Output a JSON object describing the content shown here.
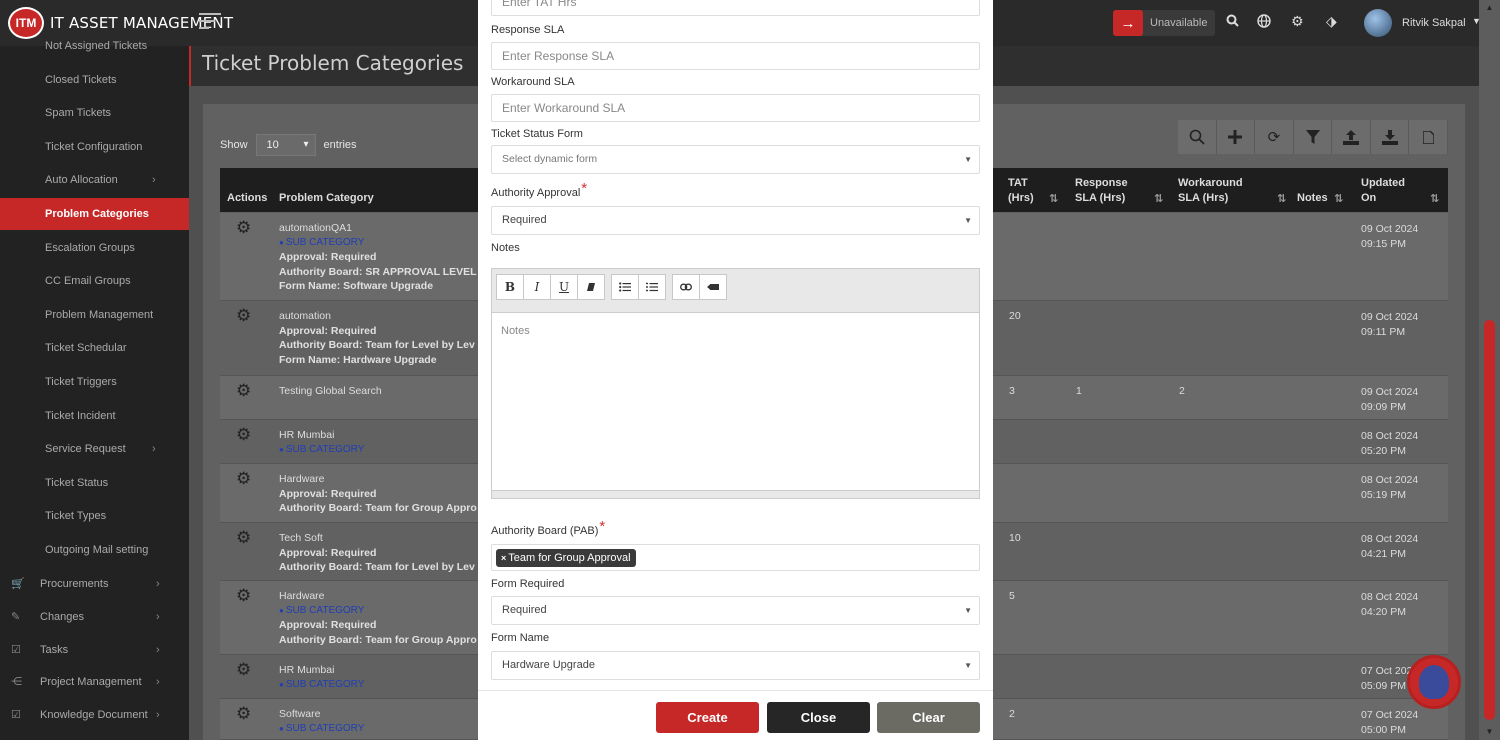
{
  "app": {
    "logo_badge": "ITM",
    "logo_text": "IT ASSET MANAGEMENT",
    "status_label": "Unavailable",
    "user_name": "Ritvik Sakpal"
  },
  "sidebar": {
    "items": [
      {
        "label": "Not Assigned Tickets"
      },
      {
        "label": "Closed Tickets"
      },
      {
        "label": "Spam Tickets"
      },
      {
        "label": "Ticket Configuration"
      },
      {
        "label": "Auto Allocation",
        "chevron": "›"
      },
      {
        "label": "Problem Categories",
        "active": true
      },
      {
        "label": "Escalation Groups"
      },
      {
        "label": "CC Email Groups"
      },
      {
        "label": "Problem Management"
      },
      {
        "label": "Ticket Schedular"
      },
      {
        "label": "Ticket Triggers"
      },
      {
        "label": "Ticket Incident"
      },
      {
        "label": "Service Request",
        "chevron": "›"
      },
      {
        "label": "Ticket Status"
      },
      {
        "label": "Ticket Types"
      },
      {
        "label": "Outgoing Mail setting"
      }
    ],
    "groups": [
      {
        "label": "Procurements",
        "icon": "cart-icon"
      },
      {
        "label": "Changes",
        "icon": "wrench-icon"
      },
      {
        "label": "Tasks",
        "icon": "check-icon"
      },
      {
        "label": "Project Management",
        "icon": "share-icon"
      },
      {
        "label": "Knowledge Document",
        "icon": "check-icon"
      }
    ]
  },
  "page": {
    "title": "Ticket Problem Categories",
    "show_label": "Show",
    "entries_value": "10",
    "entries_label": "entries"
  },
  "table": {
    "headers": {
      "actions": "Actions",
      "problem_category": "Problem Category",
      "tat_1": "TAT",
      "tat_2": "(Hrs)",
      "response_1": "Response",
      "response_2": "SLA (Hrs)",
      "workaround_1": "Workaround",
      "workaround_2": "SLA (Hrs)",
      "notes": "Notes",
      "updated_1": "Updated",
      "updated_2": "On"
    },
    "rows": [
      {
        "name": "automationQA1",
        "sub": "SUB CATEGORY",
        "approval": "Approval: Required",
        "board": "Authority Board: SR APPROVAL LEVEL E",
        "form": "Form Name: Software Upgrade",
        "tat": "",
        "resp": "",
        "work": "",
        "date": "09 Oct 2024",
        "time": "09:15 PM"
      },
      {
        "name": "automation",
        "sub": "",
        "approval": "Approval: Required",
        "board": "Authority Board: Team for Level by Lev",
        "form": "Form Name: Hardware Upgrade",
        "tat": "20",
        "resp": "",
        "work": "",
        "date": "09 Oct 2024",
        "time": "09:11 PM"
      },
      {
        "name": "Testing Global Search",
        "sub": "",
        "approval": "",
        "board": "",
        "form": "",
        "tat": "3",
        "resp": "1",
        "work": "2",
        "date": "09 Oct 2024",
        "time": "09:09 PM"
      },
      {
        "name": "HR Mumbai",
        "sub": "SUB CATEGORY",
        "approval": "",
        "board": "",
        "form": "",
        "tat": "",
        "resp": "",
        "work": "",
        "date": "08 Oct 2024",
        "time": "05:20 PM"
      },
      {
        "name": "Hardware",
        "sub": "",
        "approval": "Approval: Required",
        "board": "Authority Board: Team for Group Appro",
        "form": "",
        "tat": "",
        "resp": "",
        "work": "",
        "date": "08 Oct 2024",
        "time": "05:19 PM"
      },
      {
        "name": "Tech Soft",
        "sub": "",
        "approval": "Approval: Required",
        "board": "Authority Board: Team for Level by Lev",
        "form": "",
        "tat": "10",
        "resp": "",
        "work": "",
        "date": "08 Oct 2024",
        "time": "04:21 PM"
      },
      {
        "name": "Hardware",
        "sub": "SUB CATEGORY",
        "approval": "Approval: Required",
        "board": "Authority Board: Team for Group Appro",
        "form": "",
        "tat": "5",
        "resp": "",
        "work": "",
        "date": "08 Oct 2024",
        "time": "04:20 PM"
      },
      {
        "name": "HR Mumbai",
        "sub": "SUB CATEGORY",
        "approval": "",
        "board": "",
        "form": "",
        "tat": "",
        "resp": "",
        "work": "",
        "date": "07 Oct 2024",
        "time": "05:09 PM"
      },
      {
        "name": "Software",
        "sub": "SUB CATEGORY",
        "approval": "",
        "board": "",
        "form": "",
        "tat": "2",
        "resp": "",
        "work": "",
        "date": "07 Oct 2024",
        "time": "05:00 PM"
      }
    ]
  },
  "modal": {
    "tat_placeholder": "Enter TAT Hrs",
    "response_label": "Response SLA",
    "response_placeholder": "Enter Response SLA",
    "workaround_label": "Workaround SLA",
    "workaround_placeholder": "Enter Workaround SLA",
    "status_form_label": "Ticket Status Form",
    "status_form_placeholder": "Select dynamic form",
    "authority_label": "Authority Approval",
    "authority_value": "Required",
    "notes_label": "Notes",
    "notes_placeholder": "Notes",
    "editor_buttons": {
      "bold": "B",
      "italic": "I",
      "underline": "U"
    },
    "board_label": "Authority Board (PAB)",
    "board_tag": "Team for Group Approval",
    "form_required_label": "Form Required",
    "form_required_value": "Required",
    "form_name_label": "Form Name",
    "form_name_value": "Hardware Upgrade",
    "create_label": "Create",
    "close_label": "Close",
    "clear_label": "Clear"
  },
  "colors": {
    "accent": "#c62828",
    "sub_category": "#1f3fb6"
  }
}
